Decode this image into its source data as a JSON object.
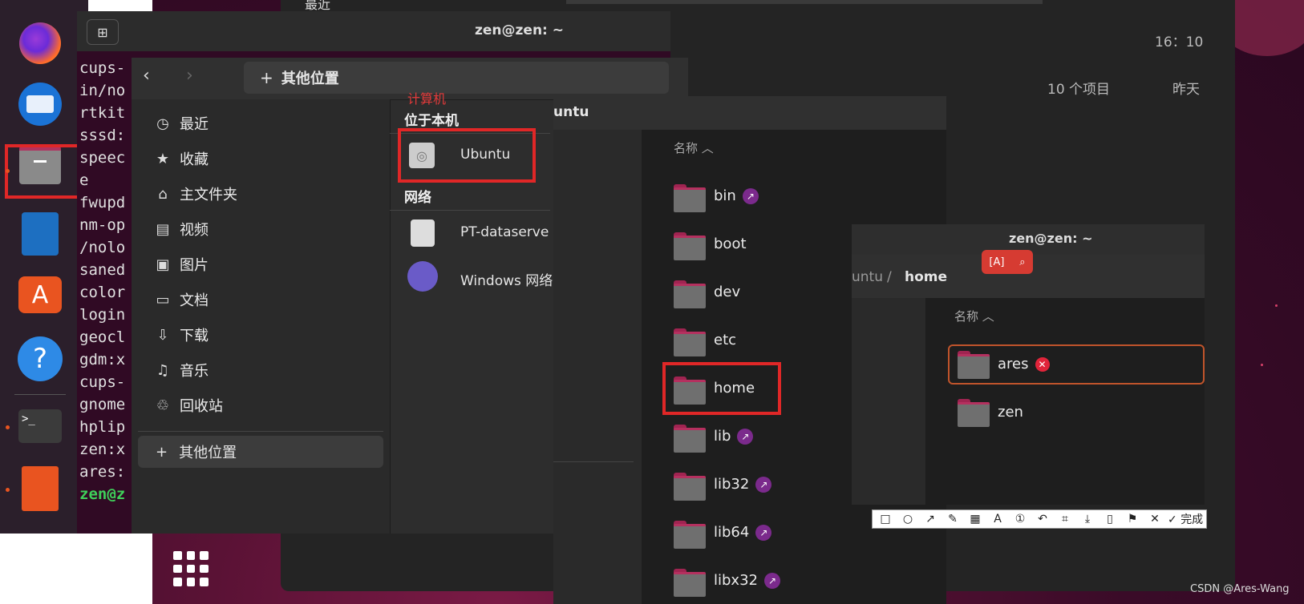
{
  "terminal": {
    "title": "zen@zen: ~",
    "lines": [
      "cups-",
      "in/no",
      "rtkit",
      "sssd:",
      "speec",
      "e",
      "fwupd",
      "nm-op",
      "/nolo",
      "saned",
      "color",
      "login",
      "geocl",
      "gdm:x",
      "cups-",
      "gnome",
      "hplip",
      "zen:x",
      "ares:",
      "zen@z"
    ]
  },
  "back_window": {
    "time": "16：10",
    "item_count": "10 个项目",
    "date": "昨天",
    "recent_label": "最近"
  },
  "files": {
    "location": "其他位置",
    "sidebar": [
      {
        "icon": "clock-icon",
        "label": "最近"
      },
      {
        "icon": "star-icon",
        "label": "收藏"
      },
      {
        "icon": "home-icon",
        "label": "主文件夹"
      },
      {
        "icon": "video-icon",
        "label": "视频"
      },
      {
        "icon": "image-icon",
        "label": "图片"
      },
      {
        "icon": "document-icon",
        "label": "文档"
      },
      {
        "icon": "download-icon",
        "label": "下载"
      },
      {
        "icon": "music-icon",
        "label": "音乐"
      },
      {
        "icon": "trash-icon",
        "label": "回收站"
      }
    ],
    "other_locations": "其他位置",
    "section_local": "位于本机",
    "local_item": "Ubuntu",
    "section_network": "网络",
    "network_items": [
      "PT-dataserve",
      "Windows 网络"
    ],
    "annotation": "计算机"
  },
  "root_window": {
    "title": "untu",
    "column_header": "名称",
    "items": [
      {
        "name": "bin",
        "link": true
      },
      {
        "name": "boot",
        "link": false
      },
      {
        "name": "dev",
        "link": false
      },
      {
        "name": "etc",
        "link": false
      },
      {
        "name": "home",
        "link": false
      },
      {
        "name": "lib",
        "link": true
      },
      {
        "name": "lib32",
        "link": true
      },
      {
        "name": "lib64",
        "link": true
      },
      {
        "name": "libx32",
        "link": true
      }
    ]
  },
  "home_window": {
    "title": "zen@zen: ~",
    "path_prefix": "untu",
    "path_sep": "/",
    "path_current": "home",
    "column_header": "名称",
    "items": [
      "ares",
      "zen"
    ]
  },
  "screenshot_toolbar": {
    "done_label": "完成"
  },
  "watermark": "CSDN @Ares-Wang"
}
